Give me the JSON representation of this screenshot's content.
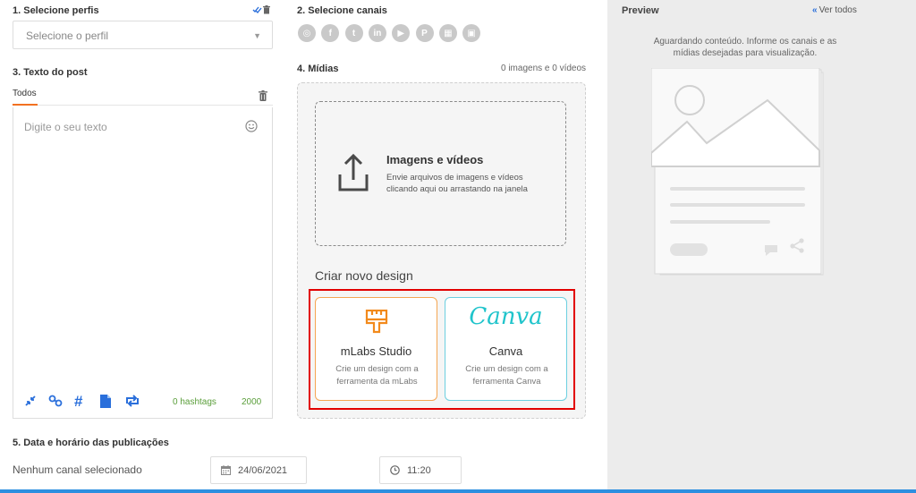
{
  "profiles": {
    "title": "1. Selecione perfis",
    "placeholder": "Selecione o perfil",
    "caret": "▼"
  },
  "text_post": {
    "title": "3. Texto do post",
    "tab": "Todos",
    "placeholder": "Digite o seu texto",
    "hashtags": "0 hashtags",
    "char_count": "2000",
    "tools": [
      "compress-icon",
      "link-icon",
      "hashtag-icon",
      "file-icon",
      "repost-icon"
    ]
  },
  "channels": {
    "title": "2. Selecione canais",
    "items": [
      {
        "name": "instagram-icon",
        "glyph": "◎"
      },
      {
        "name": "facebook-icon",
        "glyph": "f"
      },
      {
        "name": "twitter-icon",
        "glyph": "t"
      },
      {
        "name": "linkedin-icon",
        "glyph": "in"
      },
      {
        "name": "youtube-icon",
        "glyph": "▶"
      },
      {
        "name": "pinterest-icon",
        "glyph": "P"
      },
      {
        "name": "google-my-business-icon",
        "glyph": "▦"
      },
      {
        "name": "image-channel-icon",
        "glyph": "▣"
      }
    ]
  },
  "media": {
    "title": "4. Mídias",
    "count": "0 imagens e 0 vídeos",
    "upload_title": "Imagens e vídeos",
    "upload_desc": "Envie arquivos de imagens e vídeos clicando aqui ou arrastando na janela",
    "criar": "Criar novo design",
    "mlabs": {
      "name": "mLabs Studio",
      "desc": "Crie um design com a ferramenta da mLabs"
    },
    "canva": {
      "logo": "Canva",
      "name": "Canva",
      "desc": "Crie um design com a ferramenta Canva"
    }
  },
  "schedule": {
    "title": "5. Data e horário das publicações",
    "label": "Nenhum canal selecionado",
    "date": "24/06/2021",
    "time": "11:20"
  },
  "preview": {
    "title": "Preview",
    "ver_todos": "Ver todos",
    "chevron": "«",
    "message": "Aguardando conteúdo. Informe os canais e as mídias desejadas para visualização."
  },
  "colors": {
    "accent_orange": "#f27121",
    "canva_teal": "#20c4cb",
    "highlight_red": "#e20000",
    "link_blue": "#2a6fdb",
    "tool_blue": "#2a6fdb"
  }
}
